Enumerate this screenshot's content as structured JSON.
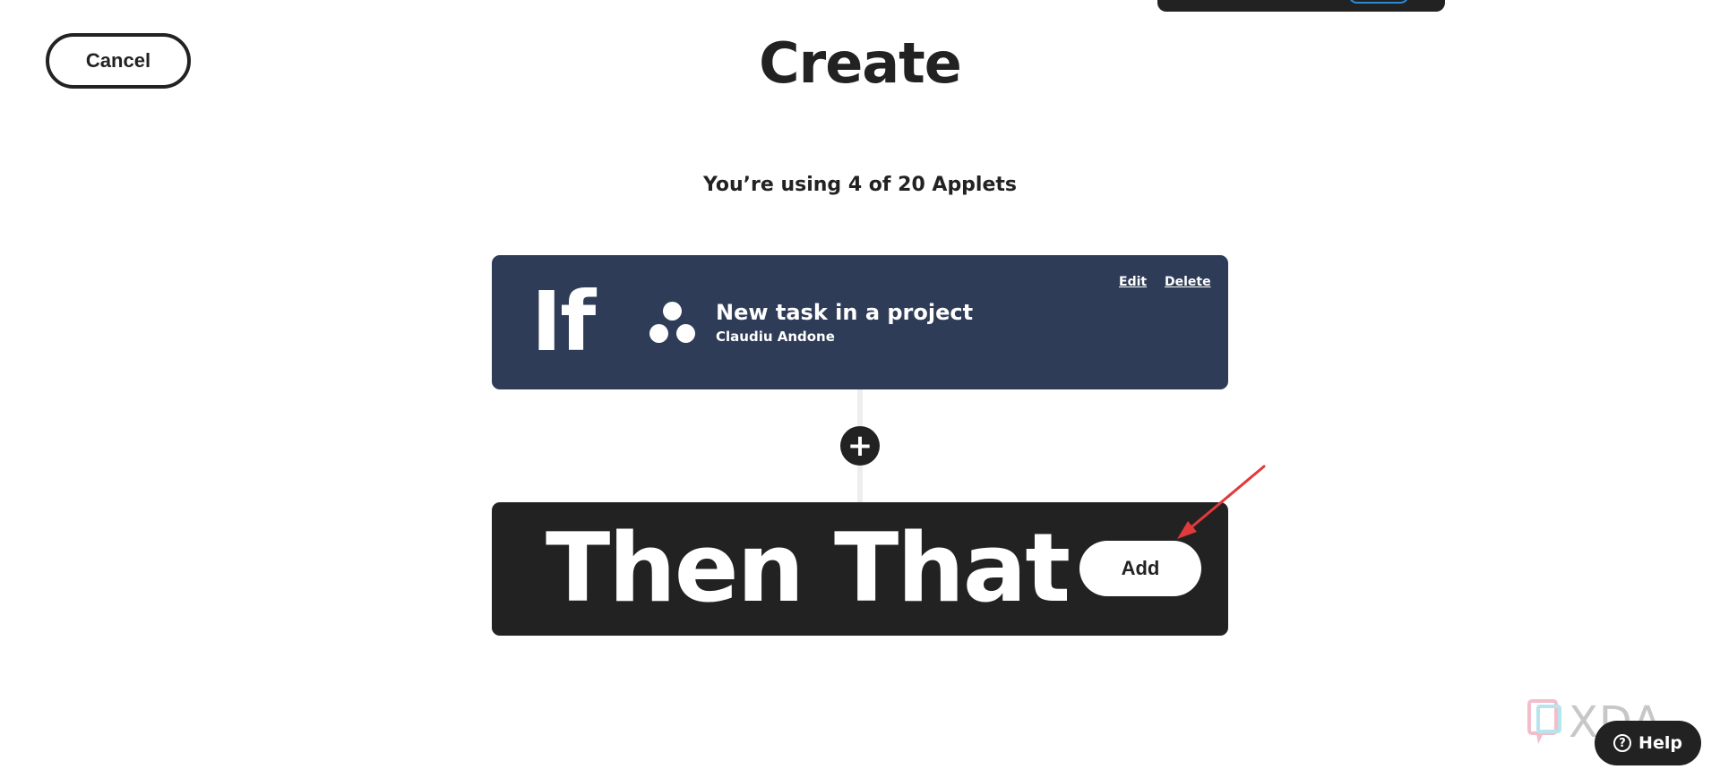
{
  "header": {
    "cancel_label": "Cancel",
    "title": "Create"
  },
  "usage_text": "You’re using 4 of 20 Applets",
  "trigger_card": {
    "if_label": "If",
    "service_icon": "asana-dots-icon",
    "title": "New task in a project",
    "subtitle": "Claudiu Andone",
    "edit_label": "Edit",
    "delete_label": "Delete",
    "background_color": "#2f3c57"
  },
  "add_step": {
    "icon": "plus-icon",
    "symbol": "+"
  },
  "action_card": {
    "then_label": "Then That",
    "add_label": "Add",
    "background_color": "#222222"
  },
  "annotation": {
    "icon": "red-arrow-icon",
    "color": "#e03a3a"
  },
  "watermark": {
    "icon": "xda-logo-icon",
    "text": "XDA"
  },
  "help": {
    "icon": "question-circle-icon",
    "symbol": "?",
    "label": "Help"
  }
}
